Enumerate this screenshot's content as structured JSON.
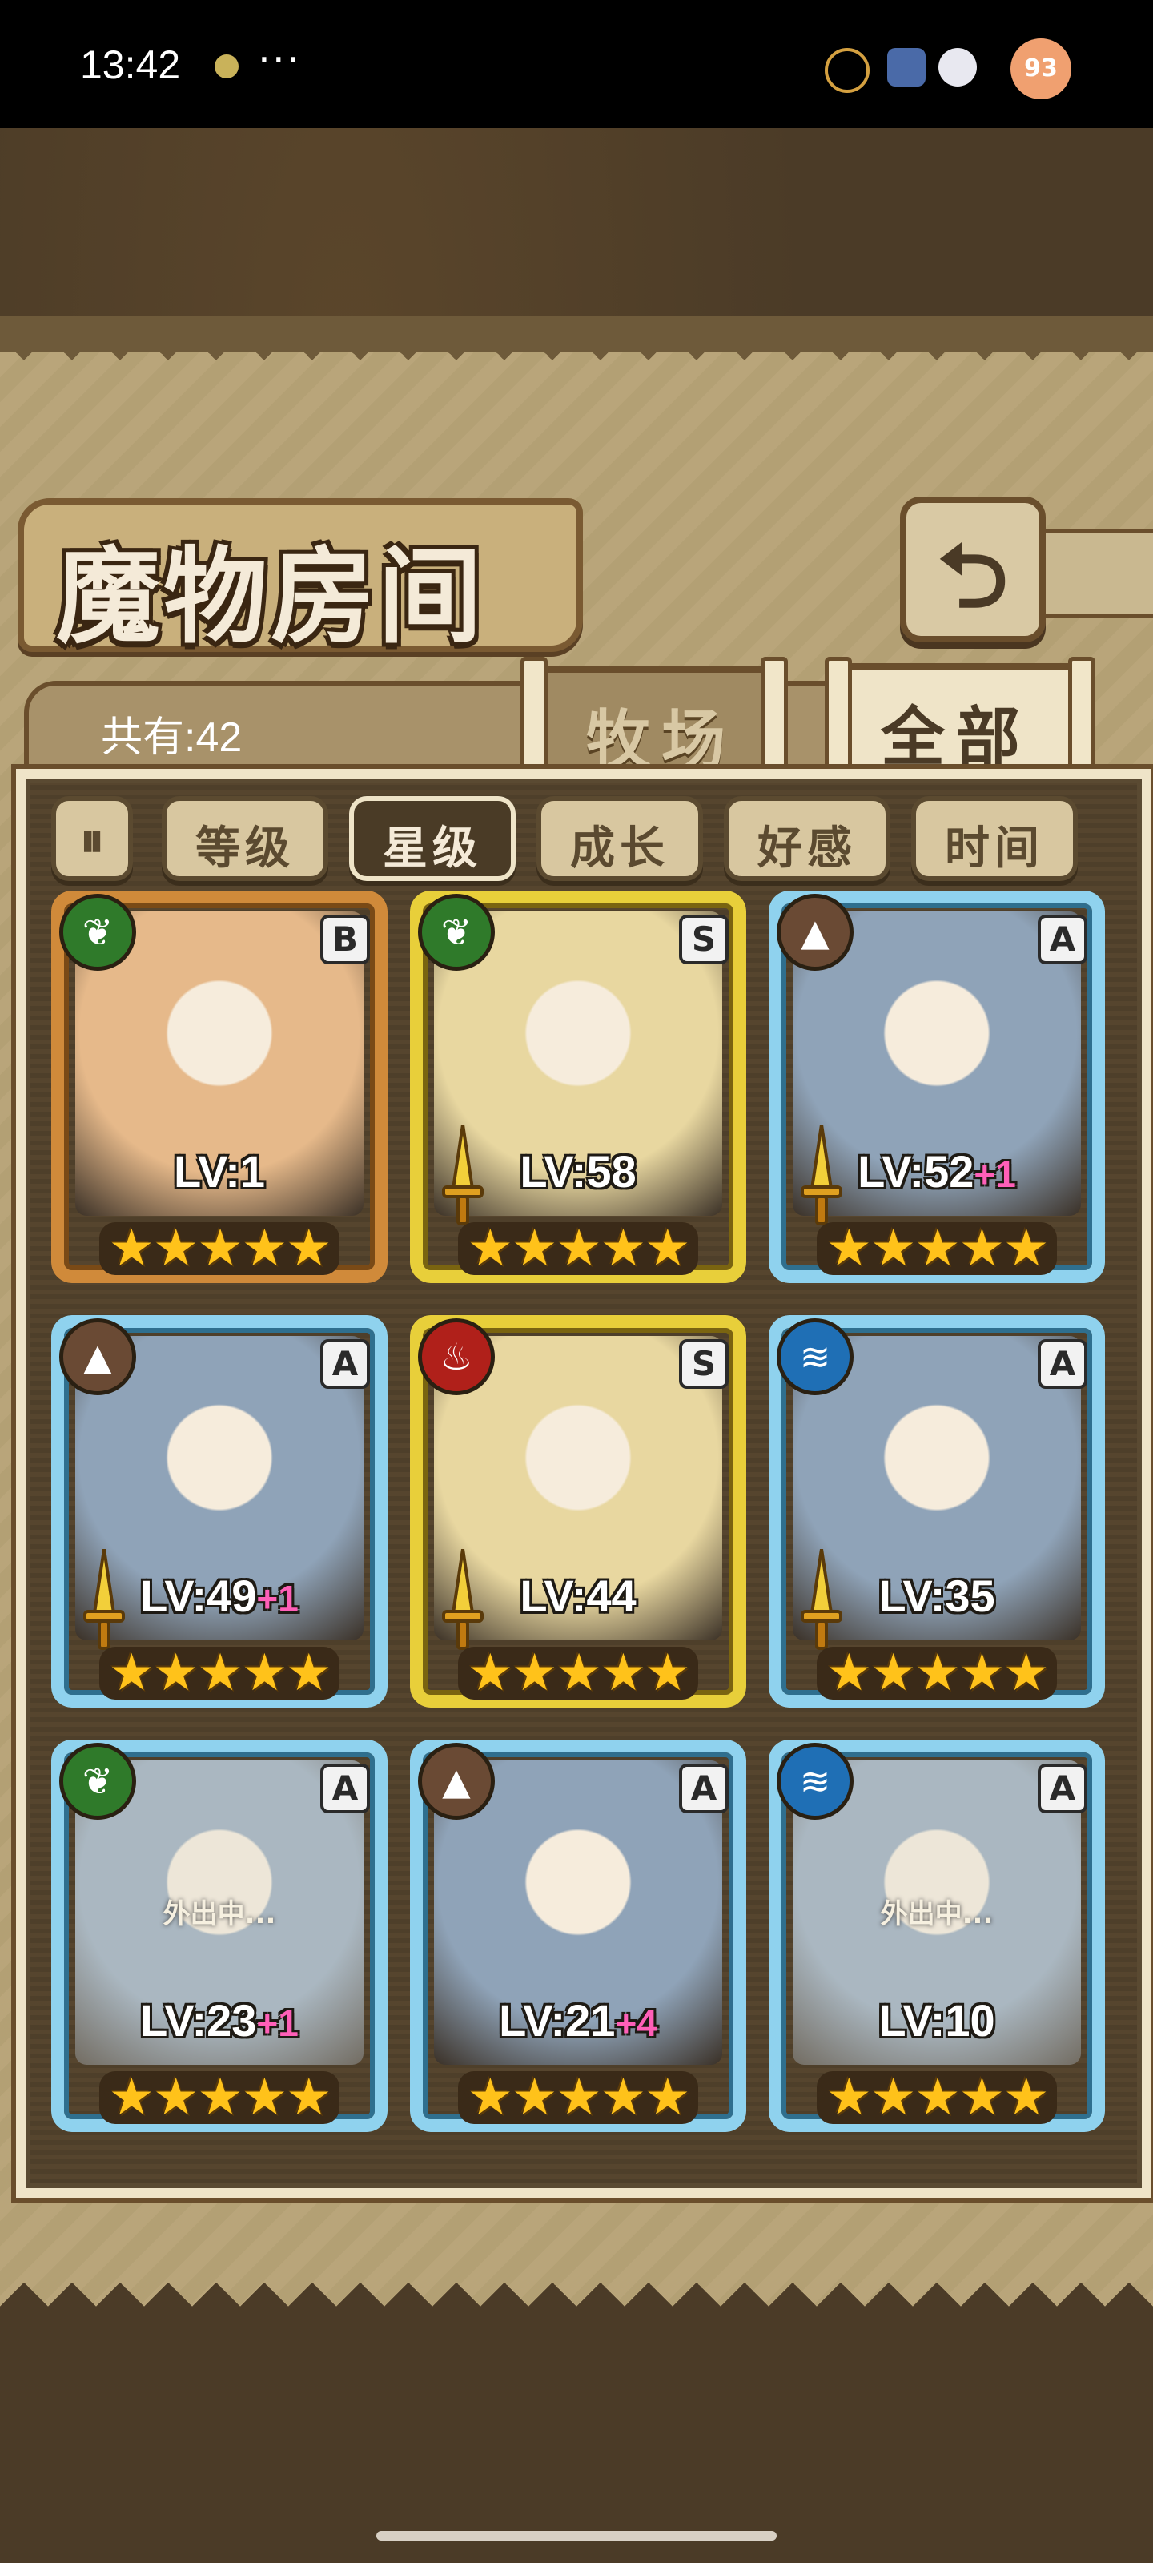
{
  "status_bar": {
    "time": "13:42",
    "dots": "···",
    "battery": "93"
  },
  "header": {
    "title": "魔物房间",
    "back_glyph": "⮌"
  },
  "count_label": "共有:42",
  "tabs": [
    {
      "label": "牧场",
      "active": false
    },
    {
      "label": "全部",
      "active": true
    }
  ],
  "sort": {
    "toggle": "⏸",
    "options": [
      {
        "label": "等级",
        "active": false
      },
      {
        "label": "星级",
        "active": true
      },
      {
        "label": "成长",
        "active": false
      },
      {
        "label": "好感",
        "active": false
      },
      {
        "label": "时间",
        "active": false
      }
    ]
  },
  "cards": [
    {
      "element": "grass",
      "rank": "B",
      "frame": "bronze",
      "lv": "LV:1",
      "plus": "",
      "stars": 5,
      "weapon": false,
      "away": ""
    },
    {
      "element": "grass",
      "rank": "S",
      "frame": "gold",
      "lv": "LV:58",
      "plus": "",
      "stars": 5,
      "weapon": true,
      "away": ""
    },
    {
      "element": "earth",
      "rank": "A",
      "frame": "blue",
      "lv": "LV:52",
      "plus": "+1",
      "stars": 5,
      "weapon": true,
      "away": ""
    },
    {
      "element": "earth",
      "rank": "A",
      "frame": "blue",
      "lv": "LV:49",
      "plus": "+1",
      "stars": 5,
      "weapon": true,
      "away": ""
    },
    {
      "element": "fire",
      "rank": "S",
      "frame": "gold",
      "lv": "LV:44",
      "plus": "",
      "stars": 5,
      "weapon": true,
      "away": ""
    },
    {
      "element": "water",
      "rank": "A",
      "frame": "blue",
      "lv": "LV:35",
      "plus": "",
      "stars": 5,
      "weapon": true,
      "away": ""
    },
    {
      "element": "grass",
      "rank": "A",
      "frame": "blue",
      "lv": "LV:23",
      "plus": "+1",
      "stars": 5,
      "weapon": false,
      "away": "外出中..."
    },
    {
      "element": "earth",
      "rank": "A",
      "frame": "blue",
      "lv": "LV:21",
      "plus": "+4",
      "stars": 5,
      "weapon": false,
      "away": ""
    },
    {
      "element": "water",
      "rank": "A",
      "frame": "blue",
      "lv": "LV:10",
      "plus": "",
      "stars": 5,
      "weapon": false,
      "away": "外出中..."
    }
  ],
  "colors": {
    "grass": "#2f7a2a",
    "earth": "#6a4a34",
    "fire": "#b0201a",
    "water": "#1f6fb5",
    "art_bronze": "#e6b98a",
    "art_gold": "#e8d7a0",
    "art_blue": "#8fa3b8"
  }
}
